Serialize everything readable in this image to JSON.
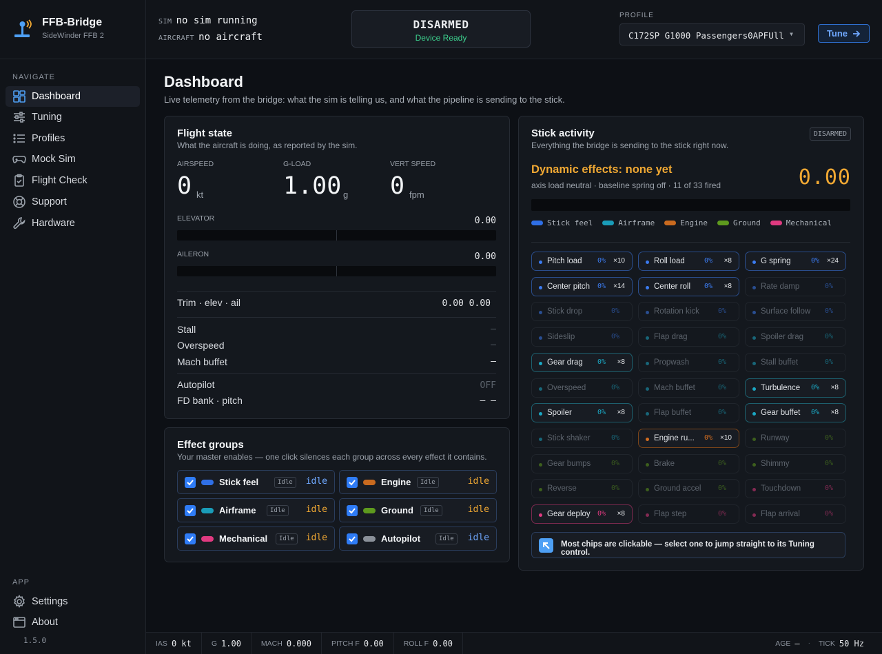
{
  "app": {
    "name": "FFB-Bridge",
    "device": "SideWinder FFB 2",
    "version": "1.5.0"
  },
  "sidebar": {
    "navigate_label": "NAVIGATE",
    "items": [
      {
        "label": "Dashboard",
        "icon": "dashboard-icon",
        "active": true
      },
      {
        "label": "Tuning",
        "icon": "sliders-icon"
      },
      {
        "label": "Profiles",
        "icon": "list-icon"
      },
      {
        "label": "Mock Sim",
        "icon": "gamepad-icon"
      },
      {
        "label": "Flight Check",
        "icon": "clipboard-check-icon"
      },
      {
        "label": "Support",
        "icon": "lifebuoy-icon"
      },
      {
        "label": "Hardware",
        "icon": "wrench-icon"
      }
    ],
    "app_label": "APP",
    "app_items": [
      {
        "label": "Settings",
        "icon": "gear-icon"
      },
      {
        "label": "About",
        "icon": "window-icon"
      }
    ]
  },
  "topbar": {
    "sim_label": "SIM",
    "sim_value": "no sim running",
    "aircraft_label": "AIRCRAFT",
    "aircraft_value": "no aircraft",
    "arm_state": "DISARMED",
    "arm_sub": "Device Ready",
    "profile_label": "PROFILE",
    "profile_value": "C172SP G1000 Passengers0APFUll",
    "tune_label": "Tune"
  },
  "page": {
    "title": "Dashboard",
    "subtitle": "Live telemetry from the bridge: what the sim is telling us, and what the pipeline is sending to the stick."
  },
  "flight_state": {
    "title": "Flight state",
    "subtitle": "What the aircraft is doing, as reported by the sim.",
    "metrics": [
      {
        "label": "AIRSPEED",
        "value": "0",
        "unit": "kt"
      },
      {
        "label": "G-LOAD",
        "value": "1.00",
        "unit": "g"
      },
      {
        "label": "VERT SPEED",
        "value": "0",
        "unit": "fpm"
      }
    ],
    "elevator_label": "ELEVATOR",
    "elevator_value": "0.00",
    "elevator_level": 0,
    "aileron_label": "AILERON",
    "aileron_value": "0.00",
    "aileron_level": 0,
    "trim_label": "Trim · elev · ail",
    "trim_value": "0.00 0.00",
    "stall_label": "Stall",
    "stall_value": "–",
    "overspeed_label": "Overspeed",
    "overspeed_value": "–",
    "mach_label": "Mach buffet",
    "mach_value": "—",
    "autopilot_label": "Autopilot",
    "autopilot_value": "OFF",
    "fd_label": "FD bank · pitch",
    "fd_value": "— —"
  },
  "effect_groups": {
    "title": "Effect groups",
    "subtitle": "Your master enables — one click silences each group across every effect it contains.",
    "groups": [
      {
        "name": "Stick feel",
        "badge": "Idle",
        "state": "idle",
        "color": "#2f6fe6",
        "state_color": "#6fa8ff"
      },
      {
        "name": "Engine",
        "badge": "Idle",
        "state": "idle",
        "color": "#c96a1f",
        "state_color": "#f0a833"
      },
      {
        "name": "Airframe",
        "badge": "Idle",
        "state": "idle",
        "color": "#1a9cb8",
        "state_color": "#f0a833"
      },
      {
        "name": "Ground",
        "badge": "Idle",
        "state": "idle",
        "color": "#5e9a1e",
        "state_color": "#f0a833"
      },
      {
        "name": "Mechanical",
        "badge": "Idle",
        "state": "idle",
        "color": "#e03a80",
        "state_color": "#f0a833"
      },
      {
        "name": "Autopilot",
        "badge": "Idle",
        "state": "idle",
        "color": "#8a9099",
        "state_color": "#6fa8ff"
      }
    ]
  },
  "stick_activity": {
    "title": "Stick activity",
    "subtitle": "Everything the bridge is sending to the stick right now.",
    "badge": "DISARMED",
    "dynamic_title": "Dynamic effects: none yet",
    "dynamic_sub": "axis load neutral · baseline spring off · 11 of 33 fired",
    "dynamic_value": "0.00",
    "legend": [
      {
        "name": "Stick feel",
        "color": "#2f6fe6"
      },
      {
        "name": "Airframe",
        "color": "#1a9cb8"
      },
      {
        "name": "Engine",
        "color": "#c96a1f"
      },
      {
        "name": "Ground",
        "color": "#5e9a1e"
      },
      {
        "name": "Mechanical",
        "color": "#e03a80"
      }
    ],
    "chips": [
      {
        "name": "Pitch load",
        "pct": "0%",
        "mult": "×10",
        "group": "stick",
        "active": true
      },
      {
        "name": "Roll load",
        "pct": "0%",
        "mult": "×8",
        "group": "stick",
        "active": true
      },
      {
        "name": "G spring",
        "pct": "0%",
        "mult": "×24",
        "group": "stick",
        "active": true
      },
      {
        "name": "Center pitch",
        "pct": "0%",
        "mult": "×14",
        "group": "stick",
        "active": true
      },
      {
        "name": "Center roll",
        "pct": "0%",
        "mult": "×8",
        "group": "stick",
        "active": true
      },
      {
        "name": "Rate damp",
        "pct": "0%",
        "mult": "",
        "group": "stick",
        "active": false
      },
      {
        "name": "Stick drop",
        "pct": "0%",
        "mult": "",
        "group": "stick",
        "active": false
      },
      {
        "name": "Rotation kick",
        "pct": "0%",
        "mult": "",
        "group": "stick",
        "active": false
      },
      {
        "name": "Surface follow",
        "pct": "0%",
        "mult": "",
        "group": "stick",
        "active": false
      },
      {
        "name": "Sideslip",
        "pct": "0%",
        "mult": "",
        "group": "stick",
        "active": false
      },
      {
        "name": "Flap drag",
        "pct": "0%",
        "mult": "",
        "group": "air",
        "active": false
      },
      {
        "name": "Spoiler drag",
        "pct": "0%",
        "mult": "",
        "group": "air",
        "active": false
      },
      {
        "name": "Gear drag",
        "pct": "0%",
        "mult": "×8",
        "group": "air",
        "active": true
      },
      {
        "name": "Propwash",
        "pct": "0%",
        "mult": "",
        "group": "air",
        "active": false
      },
      {
        "name": "Stall buffet",
        "pct": "0%",
        "mult": "",
        "group": "air",
        "active": false
      },
      {
        "name": "Overspeed",
        "pct": "0%",
        "mult": "",
        "group": "air",
        "active": false
      },
      {
        "name": "Mach buffet",
        "pct": "0%",
        "mult": "",
        "group": "air",
        "active": false
      },
      {
        "name": "Turbulence",
        "pct": "0%",
        "mult": "×8",
        "group": "air",
        "active": true
      },
      {
        "name": "Spoiler",
        "pct": "0%",
        "mult": "×8",
        "group": "air",
        "active": true
      },
      {
        "name": "Flap buffet",
        "pct": "0%",
        "mult": "",
        "group": "air",
        "active": false
      },
      {
        "name": "Gear buffet",
        "pct": "0%",
        "mult": "×8",
        "group": "air",
        "active": true
      },
      {
        "name": "Stick shaker",
        "pct": "0%",
        "mult": "",
        "group": "air",
        "active": false
      },
      {
        "name": "Engine ru...",
        "pct": "0%",
        "mult": "×10",
        "group": "eng",
        "active": true
      },
      {
        "name": "Runway",
        "pct": "0%",
        "mult": "",
        "group": "gnd",
        "active": false
      },
      {
        "name": "Gear bumps",
        "pct": "0%",
        "mult": "",
        "group": "gnd",
        "active": false
      },
      {
        "name": "Brake",
        "pct": "0%",
        "mult": "",
        "group": "gnd",
        "active": false
      },
      {
        "name": "Shimmy",
        "pct": "0%",
        "mult": "",
        "group": "gnd",
        "active": false
      },
      {
        "name": "Reverse",
        "pct": "0%",
        "mult": "",
        "group": "gnd",
        "active": false
      },
      {
        "name": "Ground accel",
        "pct": "0%",
        "mult": "",
        "group": "gnd",
        "active": false
      },
      {
        "name": "Touchdown",
        "pct": "0%",
        "mult": "",
        "group": "mech",
        "active": false
      },
      {
        "name": "Gear deploy",
        "pct": "0%",
        "mult": "×8",
        "group": "mech",
        "active": true
      },
      {
        "name": "Flap step",
        "pct": "0%",
        "mult": "",
        "group": "mech",
        "active": false
      },
      {
        "name": "Flap arrival",
        "pct": "0%",
        "mult": "",
        "group": "mech",
        "active": false
      }
    ],
    "hint": "Most chips are clickable — select one to jump straight to its Tuning control."
  },
  "statusbar": {
    "items": [
      {
        "k": "IAS",
        "v": "0 kt"
      },
      {
        "k": "G",
        "v": "1.00"
      },
      {
        "k": "MACH",
        "v": "0.000"
      },
      {
        "k": "PITCH F",
        "v": "0.00"
      },
      {
        "k": "ROLL F",
        "v": "0.00"
      }
    ],
    "age_label": "AGE",
    "age_value": "—",
    "tick_label": "TICK",
    "tick_value": "50 Hz"
  }
}
